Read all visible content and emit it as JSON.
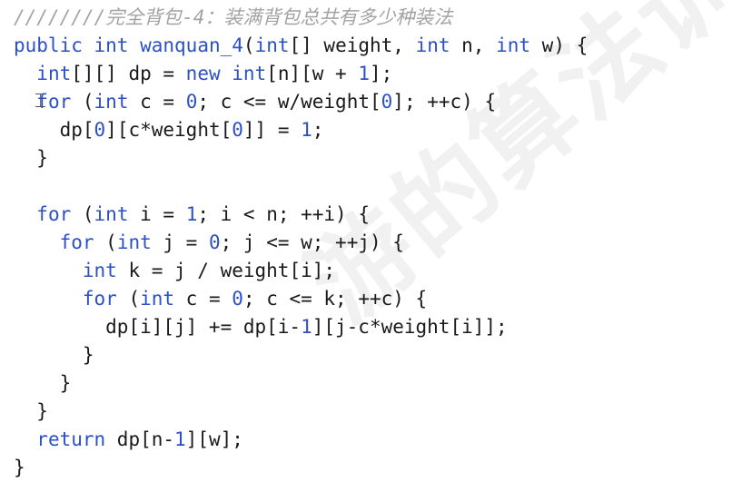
{
  "watermark_text": "游的算法训练",
  "colors": {
    "keyword": "#2b50c8",
    "number": "#2b50c8",
    "comment": "#a3a3a3",
    "text": "#1a1a1a"
  },
  "code_lines": [
    [
      {
        "t": "c",
        "v": "////////完全背包-4：装满背包总共有多少种装法"
      }
    ],
    [
      {
        "t": "k",
        "v": "public"
      },
      {
        "t": "p",
        "v": " "
      },
      {
        "t": "k",
        "v": "int"
      },
      {
        "t": "p",
        "v": " "
      },
      {
        "t": "k",
        "v": "wanquan_4"
      },
      {
        "t": "p",
        "v": "("
      },
      {
        "t": "k",
        "v": "int"
      },
      {
        "t": "p",
        "v": "[] weight, "
      },
      {
        "t": "k",
        "v": "int"
      },
      {
        "t": "p",
        "v": " n, "
      },
      {
        "t": "k",
        "v": "int"
      },
      {
        "t": "p",
        "v": " w) {"
      }
    ],
    [
      {
        "t": "p",
        "v": "  "
      },
      {
        "t": "k",
        "v": "int"
      },
      {
        "t": "p",
        "v": "[][] dp = "
      },
      {
        "t": "k",
        "v": "new"
      },
      {
        "t": "p",
        "v": " "
      },
      {
        "t": "k",
        "v": "int"
      },
      {
        "t": "p",
        "v": "[n][w + "
      },
      {
        "t": "n",
        "v": "1"
      },
      {
        "t": "p",
        "v": "];"
      }
    ],
    [
      {
        "t": "p",
        "v": "  "
      },
      {
        "t": "k",
        "v": "for"
      },
      {
        "t": "p",
        "v": " ("
      },
      {
        "t": "k",
        "v": "int"
      },
      {
        "t": "p",
        "v": " c = "
      },
      {
        "t": "n",
        "v": "0"
      },
      {
        "t": "p",
        "v": "; c <= w/weight["
      },
      {
        "t": "n",
        "v": "0"
      },
      {
        "t": "p",
        "v": "]; ++c) {"
      }
    ],
    [
      {
        "t": "p",
        "v": "    dp["
      },
      {
        "t": "n",
        "v": "0"
      },
      {
        "t": "p",
        "v": "][c*weight["
      },
      {
        "t": "n",
        "v": "0"
      },
      {
        "t": "p",
        "v": "]] = "
      },
      {
        "t": "n",
        "v": "1"
      },
      {
        "t": "p",
        "v": ";"
      }
    ],
    [
      {
        "t": "p",
        "v": "  }"
      }
    ],
    [
      {
        "t": "p",
        "v": ""
      }
    ],
    [
      {
        "t": "p",
        "v": "  "
      },
      {
        "t": "k",
        "v": "for"
      },
      {
        "t": "p",
        "v": " ("
      },
      {
        "t": "k",
        "v": "int"
      },
      {
        "t": "p",
        "v": " i = "
      },
      {
        "t": "n",
        "v": "1"
      },
      {
        "t": "p",
        "v": "; i < n; ++i) {"
      }
    ],
    [
      {
        "t": "p",
        "v": "    "
      },
      {
        "t": "k",
        "v": "for"
      },
      {
        "t": "p",
        "v": " ("
      },
      {
        "t": "k",
        "v": "int"
      },
      {
        "t": "p",
        "v": " j = "
      },
      {
        "t": "n",
        "v": "0"
      },
      {
        "t": "p",
        "v": "; j <= w; ++j) {"
      }
    ],
    [
      {
        "t": "p",
        "v": "      "
      },
      {
        "t": "k",
        "v": "int"
      },
      {
        "t": "p",
        "v": " k = j / weight[i];"
      }
    ],
    [
      {
        "t": "p",
        "v": "      "
      },
      {
        "t": "k",
        "v": "for"
      },
      {
        "t": "p",
        "v": " ("
      },
      {
        "t": "k",
        "v": "int"
      },
      {
        "t": "p",
        "v": " c = "
      },
      {
        "t": "n",
        "v": "0"
      },
      {
        "t": "p",
        "v": "; c <= k; ++c) {"
      }
    ],
    [
      {
        "t": "p",
        "v": "        dp[i][j] += dp[i-"
      },
      {
        "t": "n",
        "v": "1"
      },
      {
        "t": "p",
        "v": "][j-c*weight[i]];"
      }
    ],
    [
      {
        "t": "p",
        "v": "      }"
      }
    ],
    [
      {
        "t": "p",
        "v": "    }"
      }
    ],
    [
      {
        "t": "p",
        "v": "  }"
      }
    ],
    [
      {
        "t": "p",
        "v": "  "
      },
      {
        "t": "k",
        "v": "return"
      },
      {
        "t": "p",
        "v": " dp[n-"
      },
      {
        "t": "n",
        "v": "1"
      },
      {
        "t": "p",
        "v": "][w];"
      }
    ],
    [
      {
        "t": "p",
        "v": "}"
      }
    ]
  ]
}
